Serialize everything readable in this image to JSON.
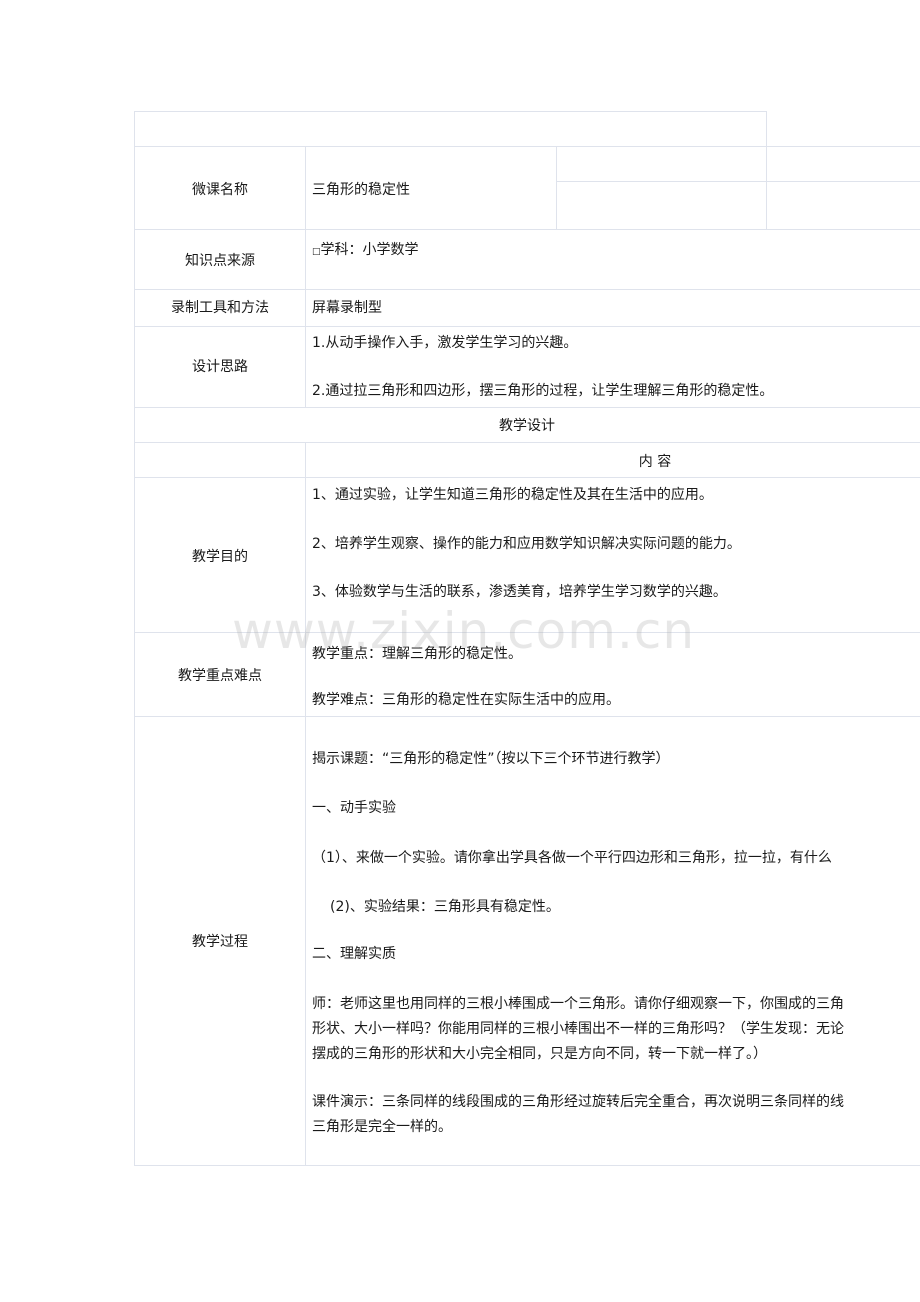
{
  "watermark": "www.zixin.com.cn",
  "rows": {
    "name": {
      "label": "微课名称",
      "value": "三角形的稳定性"
    },
    "source": {
      "label": "知识点来源",
      "checkbox": "□",
      "value": "学科：小学数学"
    },
    "tools": {
      "label": "录制工具和方法",
      "value": "屏幕录制型"
    },
    "design": {
      "label": "设计思路",
      "items": [
        "1.从动手操作入手，激发学生学习的兴趣。",
        "2.通过拉三角形和四边形，摆三角形的过程，让学生理解三角形的稳定性。"
      ]
    },
    "section": {
      "title": "教学设计",
      "content_header": "内 容"
    },
    "goals": {
      "label": "教学目的",
      "items": [
        "1、通过实验，让学生知道三角形的稳定性及其在生活中的应用。",
        "2、培养学生观察、操作的能力和应用数学知识解决实际问题的能力。",
        "3、体验数学与生活的联系，渗透美育，培养学生学习数学的兴趣。"
      ]
    },
    "key": {
      "label": "教学重点难点",
      "items": [
        "教学重点：理解三角形的稳定性。",
        "教学难点：三角形的稳定性在实际生活中的应用。"
      ]
    },
    "process": {
      "label": "教学过程",
      "lines": [
        "揭示课题：“三角形的稳定性”（按以下三个环节进行教学）",
        "一、动手实验",
        "（1）、来做一个实验。请你拿出学具各做一个平行四边形和三角形，拉一拉，有什么",
        "(2)、实验结果：三角形具有稳定性。",
        "二、理解实质",
        "师：老师这里也用同样的三根小棒围成一个三角形。请你仔细观察一下，你围成的三角",
        "形状、大小一样吗？你能用同样的三根小棒围出不一样的三角形吗？（学生发现：无论",
        "摆成的三角形的形状和大小完全相同，只是方向不同，转一下就一样了。）",
        "课件演示：三条同样的线段围成的三角形经过旋转后完全重合，再次说明三条同样的线",
        "三角形是完全一样的。"
      ]
    }
  }
}
